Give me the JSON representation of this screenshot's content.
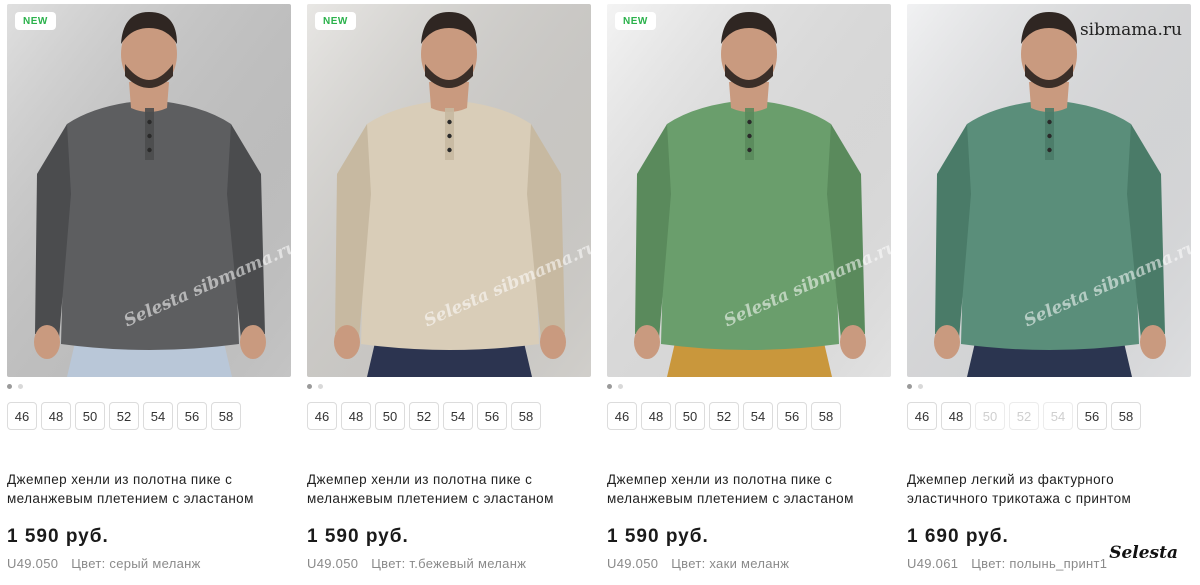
{
  "watermarks": {
    "site": "sibmama.ru",
    "brand": "Selesta",
    "photo_overlay": "Selesta sibmama.ru"
  },
  "products": [
    {
      "badge": "NEW",
      "photo": {
        "bg": "#cfcfcf",
        "shirt": "#5d5e60",
        "shirt_shade": "#4b4c4e",
        "pants": "#b9c7d8",
        "name": "grey henley jumper photo"
      },
      "sizes": [
        {
          "label": "46",
          "available": true
        },
        {
          "label": "48",
          "available": true
        },
        {
          "label": "50",
          "available": true
        },
        {
          "label": "52",
          "available": true
        },
        {
          "label": "54",
          "available": true
        },
        {
          "label": "56",
          "available": true
        },
        {
          "label": "58",
          "available": true
        }
      ],
      "title": "Джемпер хенли из полотна пике с меланжевым плетением с эластаном",
      "price": "1 590 руб.",
      "article": "U49.050",
      "color": "Цвет: серый меланж"
    },
    {
      "badge": "NEW",
      "photo": {
        "bg": "#dcdad6",
        "shirt": "#d9cdb8",
        "shirt_shade": "#c7b9a1",
        "pants": "#2c3450",
        "name": "beige henley jumper photo"
      },
      "sizes": [
        {
          "label": "46",
          "available": true
        },
        {
          "label": "48",
          "available": true
        },
        {
          "label": "50",
          "available": true
        },
        {
          "label": "52",
          "available": true
        },
        {
          "label": "54",
          "available": true
        },
        {
          "label": "56",
          "available": true
        },
        {
          "label": "58",
          "available": true
        }
      ],
      "title": "Джемпер хенли из полотна пике с меланжевым плетением с эластаном",
      "price": "1 590 руб.",
      "article": "U49.050",
      "color": "Цвет: т.бежевый меланж"
    },
    {
      "badge": "NEW",
      "photo": {
        "bg": "#eeeeee",
        "shirt": "#6a9e6c",
        "shirt_shade": "#5a8a5c",
        "pants": "#c9973c",
        "name": "khaki henley jumper photo"
      },
      "sizes": [
        {
          "label": "46",
          "available": true
        },
        {
          "label": "48",
          "available": true
        },
        {
          "label": "50",
          "available": true
        },
        {
          "label": "52",
          "available": true
        },
        {
          "label": "54",
          "available": true
        },
        {
          "label": "56",
          "available": true
        },
        {
          "label": "58",
          "available": true
        }
      ],
      "title": "Джемпер хенли из полотна пике с меланжевым плетением с эластаном",
      "price": "1 590 руб.",
      "article": "U49.050",
      "color": "Цвет: хаки меланж"
    },
    {
      "badge": "",
      "photo": {
        "bg": "#e9eaec",
        "shirt": "#5a8e7a",
        "shirt_shade": "#4a7b68",
        "pants": "#2b3550",
        "name": "wormwood print jumper photo"
      },
      "sizes": [
        {
          "label": "46",
          "available": true
        },
        {
          "label": "48",
          "available": true
        },
        {
          "label": "50",
          "available": false
        },
        {
          "label": "52",
          "available": false
        },
        {
          "label": "54",
          "available": false
        },
        {
          "label": "56",
          "available": true
        },
        {
          "label": "58",
          "available": true
        }
      ],
      "title": "Джемпер легкий из фактурного эластичного трикотажа с принтом",
      "price": "1 690 руб.",
      "article": "U49.061",
      "color": "Цвет: полынь_принт1"
    }
  ]
}
